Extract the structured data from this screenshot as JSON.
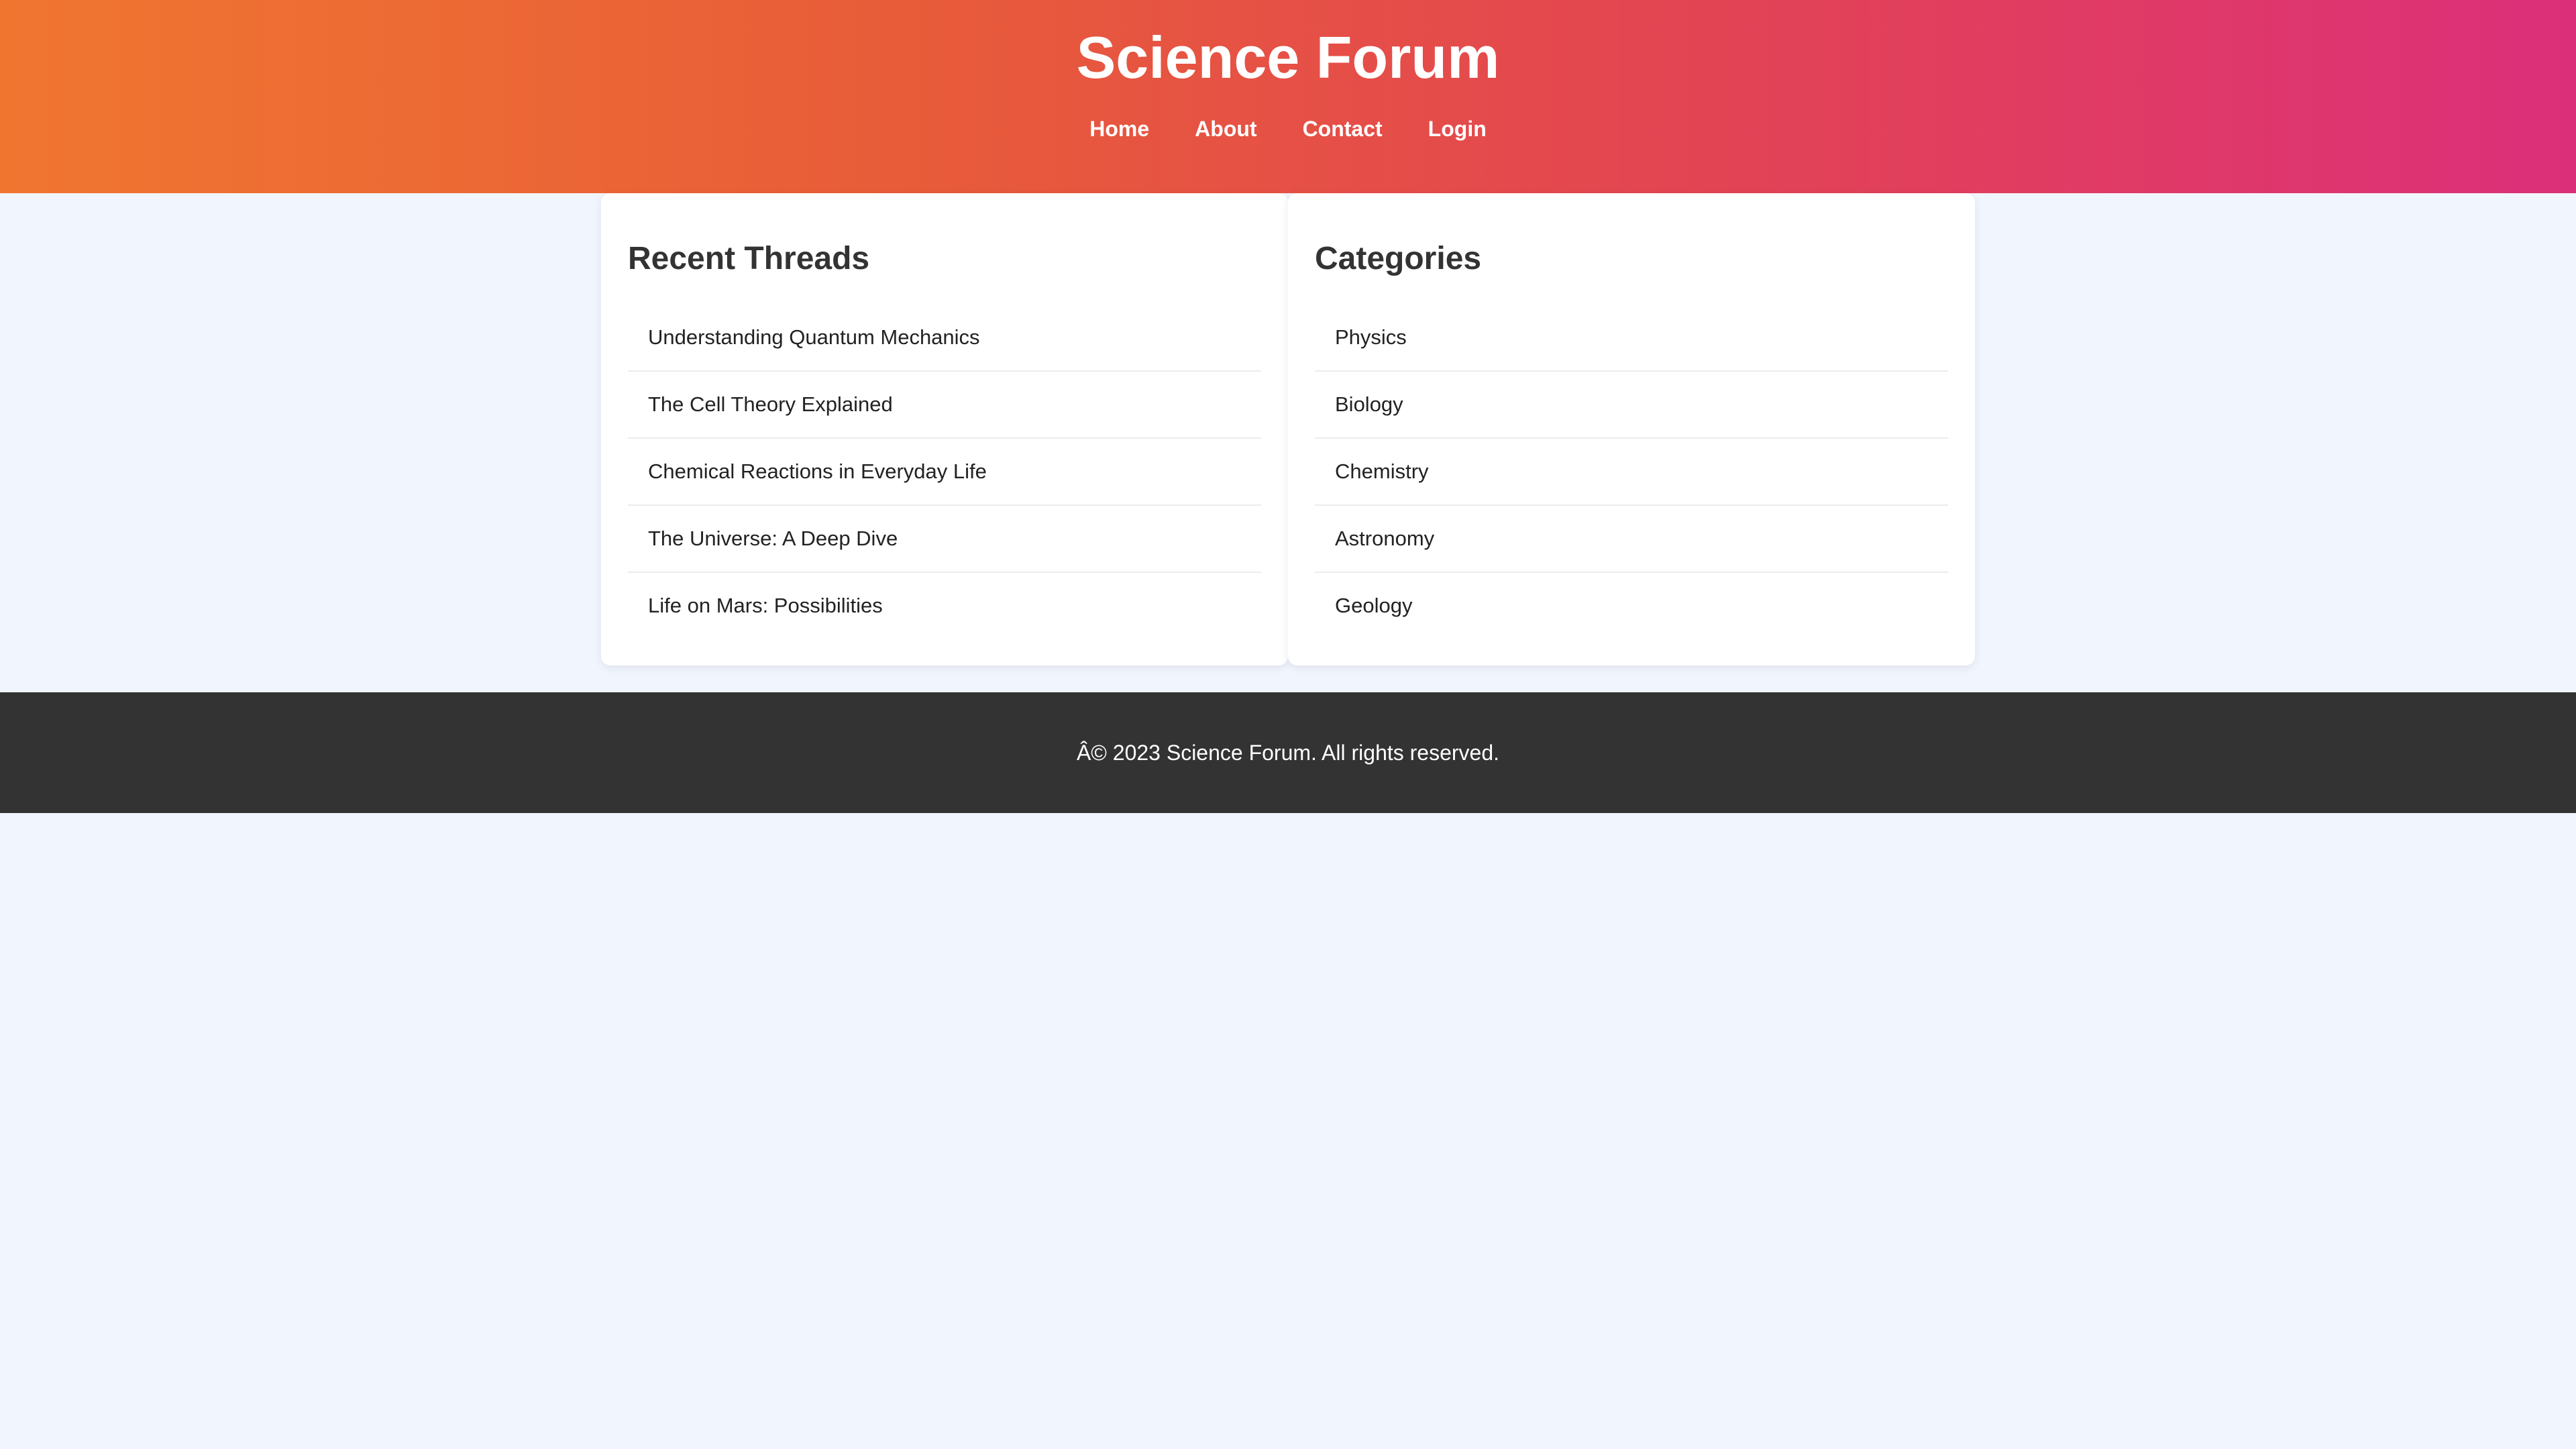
{
  "header": {
    "title": "Science Forum",
    "nav": [
      "Home",
      "About",
      "Contact",
      "Login"
    ]
  },
  "recent_threads": {
    "title": "Recent Threads",
    "items": [
      "Understanding Quantum Mechanics",
      "The Cell Theory Explained",
      "Chemical Reactions in Everyday Life",
      "The Universe: A Deep Dive",
      "Life on Mars: Possibilities"
    ]
  },
  "categories": {
    "title": "Categories",
    "items": [
      "Physics",
      "Biology",
      "Chemistry",
      "Astronomy",
      "Geology"
    ]
  },
  "footer": {
    "text": "Â© 2023 Science Forum. All rights reserved."
  },
  "colors": {
    "header_gradient_start": "#f07630",
    "header_gradient_end": "#dc2f7a",
    "page_background": "#f1f6fe",
    "footer_background": "#333333"
  }
}
